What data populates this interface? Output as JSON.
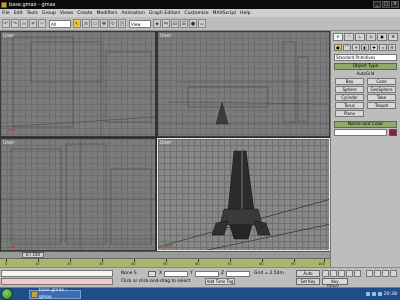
{
  "window": {
    "title": "base.gmax - gmax"
  },
  "menu": [
    "File",
    "Edit",
    "Tools",
    "Group",
    "Views",
    "Create",
    "Modifiers",
    "Animation",
    "Graph Editors",
    "Customize",
    "MAXScript",
    "Help"
  ],
  "toolbar": {
    "selection_filter": "All",
    "view_select": "View"
  },
  "viewports": {
    "top_left": "User",
    "top_right": "User",
    "bottom_left": "User",
    "bottom_right": "User"
  },
  "time_slider": {
    "label": "0 / 100"
  },
  "trackbar_ticks": [
    "0",
    "10",
    "20",
    "30",
    "40",
    "50",
    "60",
    "70",
    "80",
    "90",
    "100"
  ],
  "status": {
    "selection": "None S",
    "prompt": "Click or click-and-drag to select",
    "add_time_tag": "Add Time Tag",
    "x_label": "X",
    "y_label": "Y",
    "z_label": "Z",
    "grid": "Grid = 2.54m",
    "auto_key": "Auto",
    "set_key": "Set Key",
    "key_filters": "Key Filters..."
  },
  "command_panel": {
    "dropdown": "Standard Primitives",
    "object_type_title": "Object Type",
    "autogrid": "AutoGrid",
    "objects": [
      "Box",
      "Cone",
      "Sphere",
      "GeoSphere",
      "Cylinder",
      "Tube",
      "Torus",
      "Teapot",
      "Plane"
    ],
    "name_color_title": "Name and Color"
  },
  "taskbar": {
    "task": "base.gmax - gmax",
    "clock": "20:38"
  },
  "colors": {
    "accent_green": "#8fa96a",
    "object_color": "#8b1f3d",
    "active_tool": "#f0c040"
  }
}
